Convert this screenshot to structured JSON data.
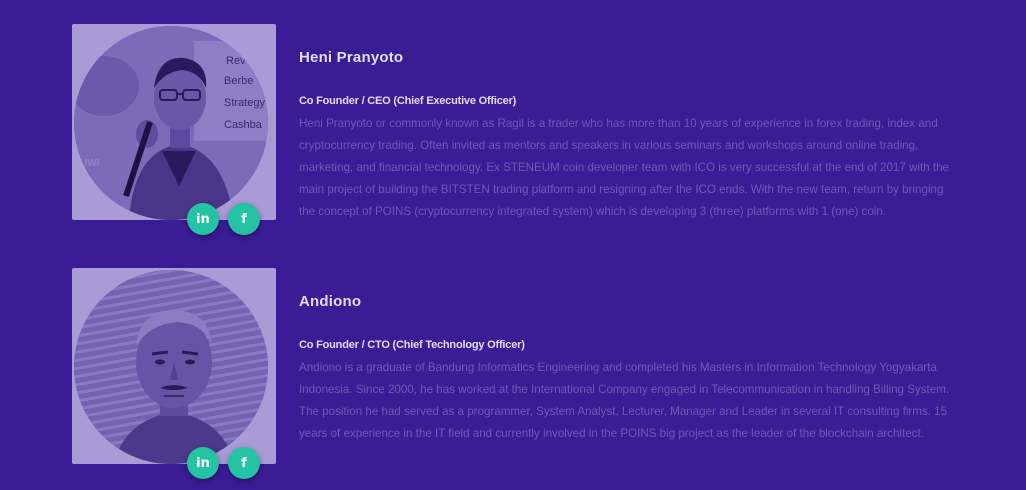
{
  "members": [
    {
      "name": "Heni Pranyoto",
      "role": "Co Founder / CEO (Chief Executive Officer)",
      "bio": "Heni Pranyoto or commonly known as Ragil is a trader who has more than 10 years of experience in forex trading, index and cryptocurrency trading. Often invited as mentors and speakers in various seminars and workshops around online trading, marketing, and financial technology. Ex STENEUM coin developer team with ICO is very successful at the end of 2017 with the main project of building the BITSTEN trading platform and resigning after the ICO ends. With the new team, return by bringing the concept of POINS (cryptocurrency integrated system) which is developing 3 (three) platforms with 1 (one) coin.",
      "photo_text": [
        "Rev",
        "Berbe",
        "Strategy",
        "Cashba",
        "UWI"
      ],
      "linkedin_glyph": "in",
      "facebook_glyph": "f"
    },
    {
      "name": "Andiono",
      "role": "Co Founder / CTO (Chief Technology Officer)",
      "bio": "Andiono is a graduate of Bandung Informatics Engineering and completed his Masters in Information Technology Yogyakarta Indonesia. Since 2000, he has worked at the International Company engaged in Telecommunication in handling Billing System. The position he had served as a programmer, System Analyst, Lecturer, Manager and Leader in several IT consulting firms. 15 years of experience in the IT field and currently involved in the POINS big project as the leader of the blockchain architect.",
      "linkedin_glyph": "in",
      "facebook_glyph": "f"
    }
  ],
  "colors": {
    "background": "#3a1c94",
    "social_button": "#24c3a3",
    "heading_text": "#e2dcf8",
    "body_text": "#6f5ab5"
  }
}
